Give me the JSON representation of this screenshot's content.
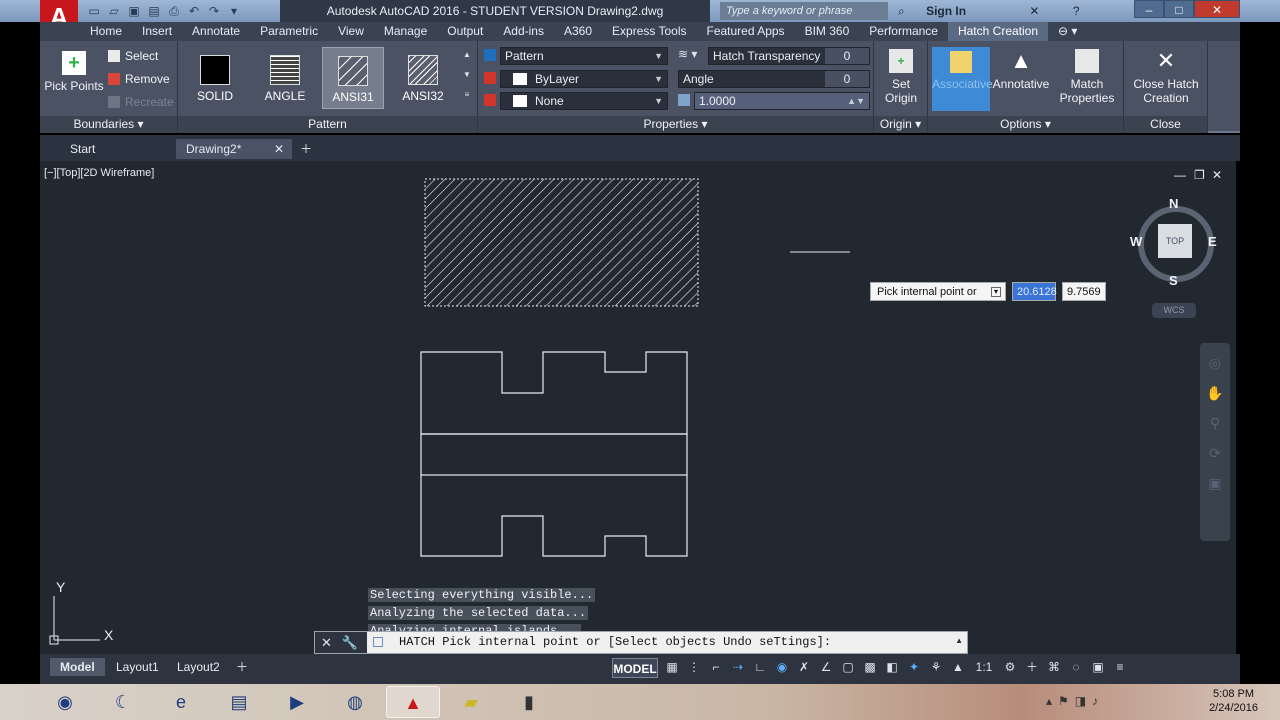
{
  "app": {
    "title": "Autodesk AutoCAD 2016 - STUDENT VERSION   Drawing2.dwg",
    "logo": "A",
    "search_placeholder": "Type a keyword or phrase",
    "sign_in": "Sign In"
  },
  "ribbon_tabs": [
    "Home",
    "Insert",
    "Annotate",
    "Parametric",
    "View",
    "Manage",
    "Output",
    "Add-ins",
    "A360",
    "Express Tools",
    "Featured Apps",
    "BIM 360",
    "Performance",
    "Hatch Creation"
  ],
  "boundaries": {
    "pick_points": "Pick Points",
    "select": "Select",
    "remove": "Remove",
    "recreate": "Recreate",
    "title": "Boundaries"
  },
  "pattern": {
    "items": [
      "SOLID",
      "ANGLE",
      "ANSI31",
      "ANSI32"
    ],
    "selected": "ANSI31",
    "title": "Pattern"
  },
  "properties": {
    "type": "Pattern",
    "color": "ByLayer",
    "background": "None",
    "transparency_label": "Hatch Transparency",
    "transparency_value": "0",
    "angle_label": "Angle",
    "angle_value": "0",
    "scale_value": "1.0000",
    "title": "Properties"
  },
  "origin": {
    "set_origin": "Set Origin",
    "title": "Origin"
  },
  "options": {
    "associative": "Associative",
    "annotative": "Annotative",
    "match_properties": "Match Properties",
    "title": "Options"
  },
  "close": {
    "close_label": "Close Hatch Creation",
    "title": "Close"
  },
  "file_tabs": {
    "start": "Start",
    "drawing": "Drawing2*"
  },
  "viewport": {
    "label": "[−][Top][2D Wireframe]",
    "compass_top": "TOP",
    "compass_n": "N",
    "compass_s": "S",
    "compass_e": "E",
    "compass_w": "W",
    "wcs": "WCS"
  },
  "dynamic_input": {
    "prompt": "Pick internal point or",
    "x": "20.6128",
    "y": "9.7569"
  },
  "command_history": [
    "Selecting everything visible...",
    "Analyzing the selected data...",
    "Analyzing internal islands..."
  ],
  "command_line": {
    "command": "HATCH",
    "prompt": "Pick internal point or [Select objects Undo seTtings]:"
  },
  "ucs": {
    "x": "X",
    "y": "Y"
  },
  "layout_tabs": [
    "Model",
    "Layout1",
    "Layout2"
  ],
  "status": {
    "model": "MODEL",
    "scale": "1:1"
  },
  "taskbar": {
    "time": "5:08 PM",
    "date": "2/24/2016"
  }
}
